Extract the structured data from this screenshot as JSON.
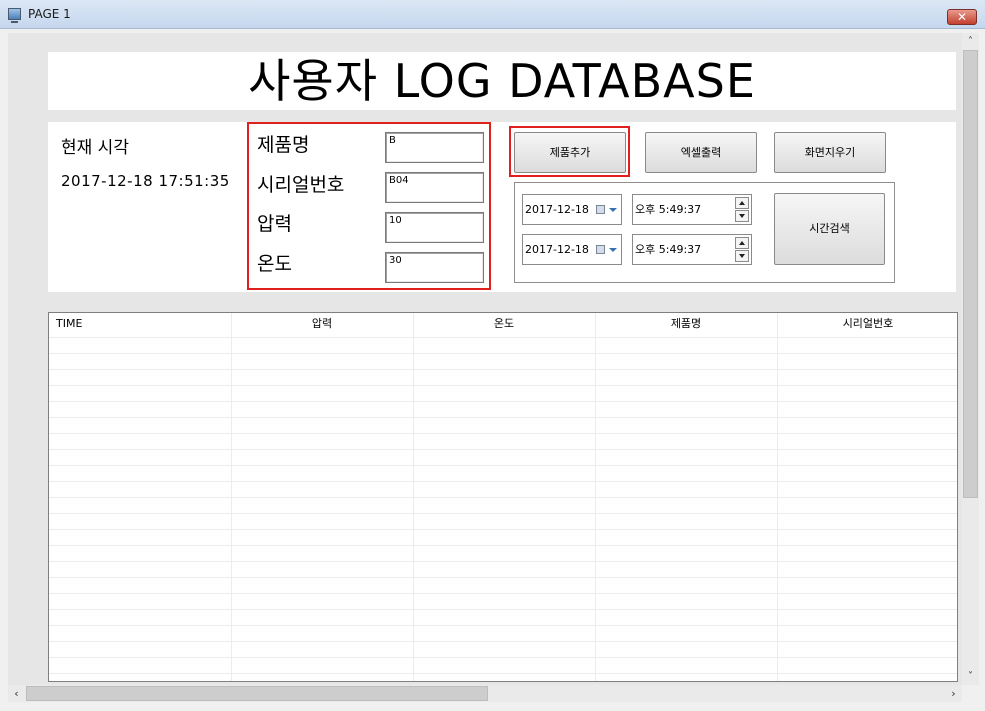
{
  "window": {
    "title": "PAGE 1",
    "close_glyph": "✕",
    "app_icon": "monitor-icon"
  },
  "header": {
    "title": "사용자 LOG DATABASE"
  },
  "clock": {
    "label": "현재 시각",
    "value": "2017-12-18 17:51:35"
  },
  "fields": [
    {
      "label": "제품명",
      "value": "B"
    },
    {
      "label": "시리얼번호",
      "value": "B04"
    },
    {
      "label": "압력",
      "value": "10"
    },
    {
      "label": "온도",
      "value": "30"
    }
  ],
  "buttons": {
    "add_product": "제품추가",
    "excel_export": "엑셀출력",
    "clear_screen": "화면지우기",
    "time_search": "시간검색"
  },
  "time_search": {
    "start_date": "2017-12-18",
    "start_time": "오후  5:49:37",
    "end_date": "2017-12-18",
    "end_time": "오후  5:49:37"
  },
  "grid": {
    "columns": [
      "TIME",
      "압력",
      "온도",
      "제품명",
      "시리얼번호"
    ],
    "rows": []
  },
  "scrollbars": {
    "up_glyph": "˄",
    "down_glyph": "˅",
    "left_glyph": "‹",
    "right_glyph": "›"
  },
  "colors": {
    "highlight": "#e0201c",
    "accent": "#3a6fb5"
  }
}
